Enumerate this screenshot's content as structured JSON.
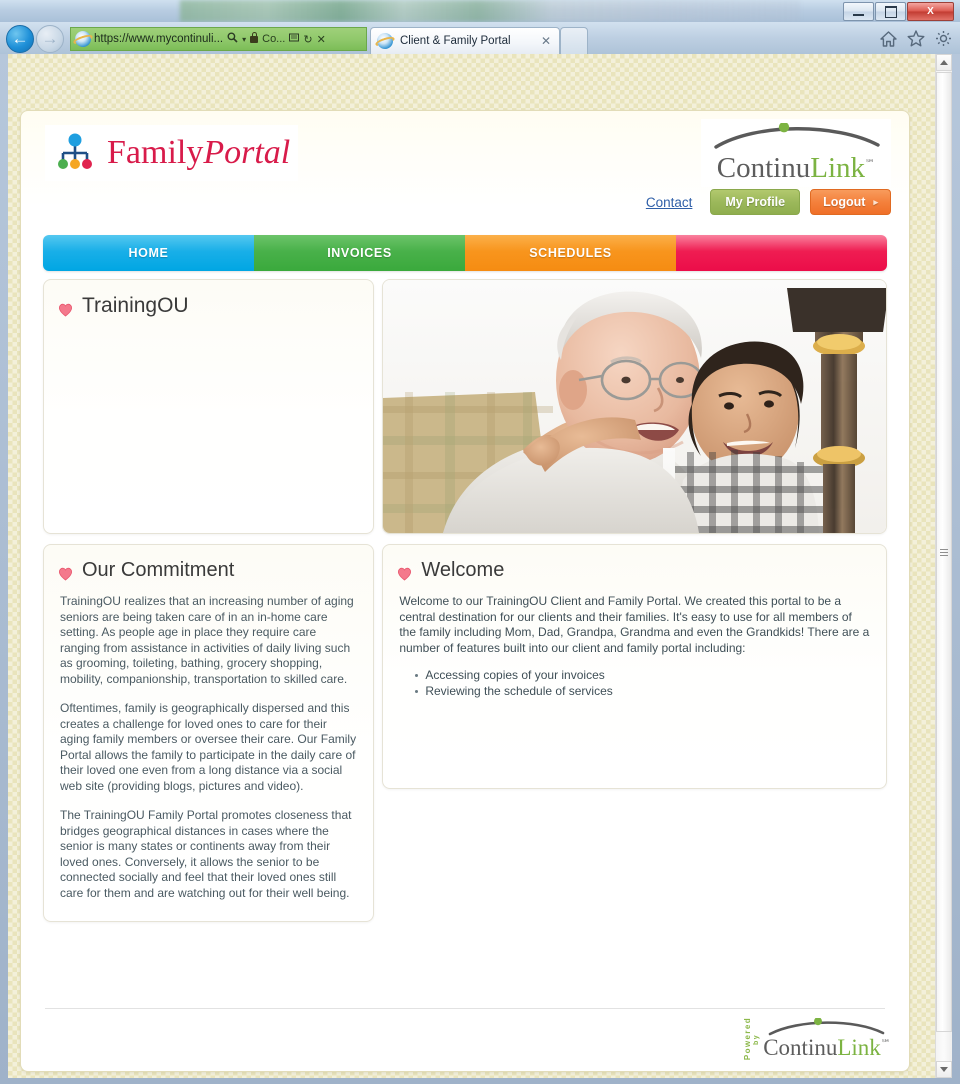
{
  "browser": {
    "window_buttons": {
      "minimize": "–",
      "maximize": "□",
      "close": "X"
    },
    "back_label": "←",
    "forward_label": "→",
    "address_url": "https://www.mycontinuli...",
    "address_search_icon": "search-icon",
    "address_security_label": "Co...",
    "address_compat_icon": "compatibility-view-icon",
    "address_refresh_icon": "↻",
    "address_stop_icon": "✕",
    "tab_title": "Client & Family Portal",
    "tab_close": "✕",
    "toolbar_icons": [
      "home-icon",
      "favorites-star-icon",
      "settings-gear-icon"
    ]
  },
  "header": {
    "logo_text_family": "Family",
    "logo_text_portal": "Portal",
    "brand_continu": "Continu",
    "brand_link": "Link",
    "brand_sm": "℠",
    "contact_label": "Contact",
    "profile_label": "My Profile",
    "logout_label": "Logout",
    "logout_arrow": "▸"
  },
  "nav": {
    "tabs": [
      {
        "label": "HOME",
        "color": "#00a6e3"
      },
      {
        "label": "INVOICES",
        "color": "#3aa93c"
      },
      {
        "label": "SCHEDULES",
        "color": "#f68c12"
      },
      {
        "label": "",
        "color": "#ec0d49"
      }
    ]
  },
  "org": {
    "name": "TrainingOU"
  },
  "commitment": {
    "title": "Our Commitment",
    "paragraphs": [
      "TrainingOU realizes that an increasing number of aging seniors are being taken care of in an in-home care setting. As people age in place they require care ranging from assistance in activities of daily living such as grooming, toileting, bathing, grocery shopping, mobility, companionship, transportation to skilled care.",
      "Oftentimes, family is geographically dispersed and this creates a challenge for loved ones to care for their aging family members or oversee their care. Our Family Portal allows the family to participate in the daily care of their loved one even from a long distance via a social web site (providing blogs, pictures and video).",
      "The TrainingOU Family Portal promotes closeness that bridges geographical distances in cases where the senior is many states or continents away from their loved ones. Conversely, it allows the senior to be connected socially and feel that their loved ones still care for them and are watching out for their well being."
    ]
  },
  "welcome": {
    "title": "Welcome",
    "intro": "Welcome to our TrainingOU Client and Family Portal. We created this portal to be a central destination for our clients and their families. It's easy to use for all members of the family including Mom, Dad, Grandpa, Grandma and even the Grandkids! There are a number of features built into our client and family portal including:",
    "features": [
      "Accessing copies of your invoices",
      "Reviewing the schedule of services"
    ]
  },
  "hero": {
    "alt": "elderly man being hugged by a young boy"
  },
  "footer": {
    "powered_word": "Powered",
    "by_word": "by",
    "brand_continu": "Continu",
    "brand_link": "Link",
    "brand_sm": "℠"
  },
  "colors": {
    "accent_pink": "#d81b4a",
    "brand_green": "#7cb342",
    "tab_home": "#00a6e3",
    "tab_invoices": "#3aa93c",
    "tab_schedules": "#f68c12",
    "tab_blank": "#ec0d49",
    "page_bg": "#e9e4bc"
  }
}
